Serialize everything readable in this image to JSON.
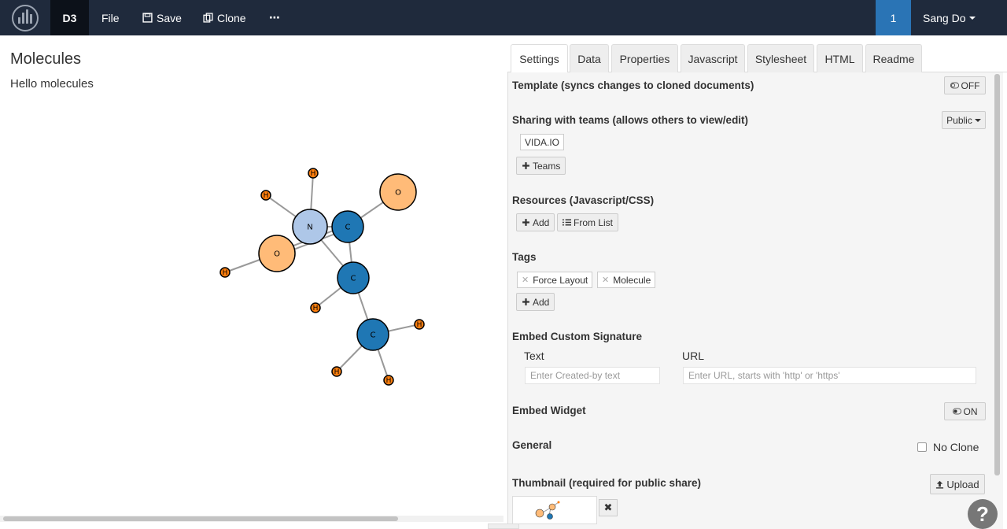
{
  "nav": {
    "brand": "D3",
    "file": "File",
    "save": "Save",
    "clone": "Clone",
    "more": "⋯",
    "notifications": "1",
    "user": "Sang Do"
  },
  "document": {
    "title": "Molecules",
    "description": "Hello molecules"
  },
  "molecule": {
    "atoms": [
      {
        "label": "N",
        "color": "#aec7e8"
      },
      {
        "label": "C",
        "color": "#1f77b4"
      },
      {
        "label": "O",
        "color": "#ffbb78"
      },
      {
        "label": "O",
        "color": "#ffbb78"
      },
      {
        "label": "C",
        "color": "#1f77b4"
      },
      {
        "label": "C",
        "color": "#1f77b4"
      },
      {
        "label": "H",
        "color": "#ff7f0e"
      },
      {
        "label": "H",
        "color": "#ff7f0e"
      },
      {
        "label": "H",
        "color": "#ff7f0e"
      },
      {
        "label": "H",
        "color": "#ff7f0e"
      },
      {
        "label": "H",
        "color": "#ff7f0e"
      },
      {
        "label": "H",
        "color": "#ff7f0e"
      },
      {
        "label": "H",
        "color": "#ff7f0e"
      }
    ]
  },
  "tabs": [
    "Settings",
    "Data",
    "Properties",
    "Javascript",
    "Stylesheet",
    "HTML",
    "Readme"
  ],
  "settings": {
    "template_title": "Template (syncs changes to cloned documents)",
    "template_toggle": "OFF",
    "sharing_title": "Sharing with teams (allows others to view/edit)",
    "sharing_value": "Public",
    "team_name": "VIDA.IO",
    "teams_button": "Teams",
    "resources_title": "Resources (Javascript/CSS)",
    "add_button": "Add",
    "from_list_button": "From List",
    "tags_title": "Tags",
    "tags": [
      "Force Layout",
      "Molecule"
    ],
    "tags_add_button": "Add",
    "signature_title": "Embed Custom Signature",
    "text_label": "Text",
    "text_placeholder": "Enter Created-by text",
    "url_label": "URL",
    "url_placeholder": "Enter URL, starts with 'http' or 'https'",
    "widget_title": "Embed Widget",
    "widget_toggle": "ON",
    "general_title": "General",
    "no_clone_label": "No Clone",
    "thumbnail_title": "Thumbnail (required for public share)",
    "upload_button": "Upload",
    "thumbnail_remove": "✖"
  },
  "help": "?"
}
